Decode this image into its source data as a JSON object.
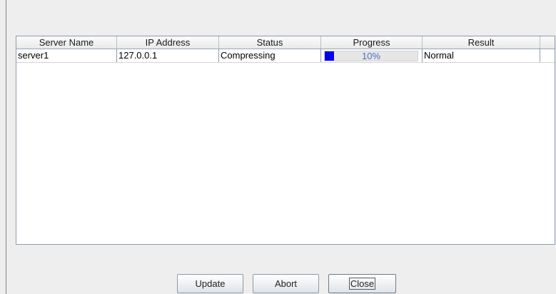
{
  "table": {
    "columns": [
      "Server Name",
      "IP Address",
      "Status",
      "Progress",
      "Result"
    ],
    "rows": [
      {
        "server_name": "server1",
        "ip_address": "127.0.0.1",
        "status": "Compressing",
        "progress_percent": 10,
        "progress_label": "10%",
        "result": "Normal"
      }
    ]
  },
  "buttons": {
    "update": "Update",
    "abort": "Abort",
    "close": "Close"
  },
  "colors": {
    "progress_fill": "#0000ee",
    "progress_text": "#4a6fc4"
  }
}
